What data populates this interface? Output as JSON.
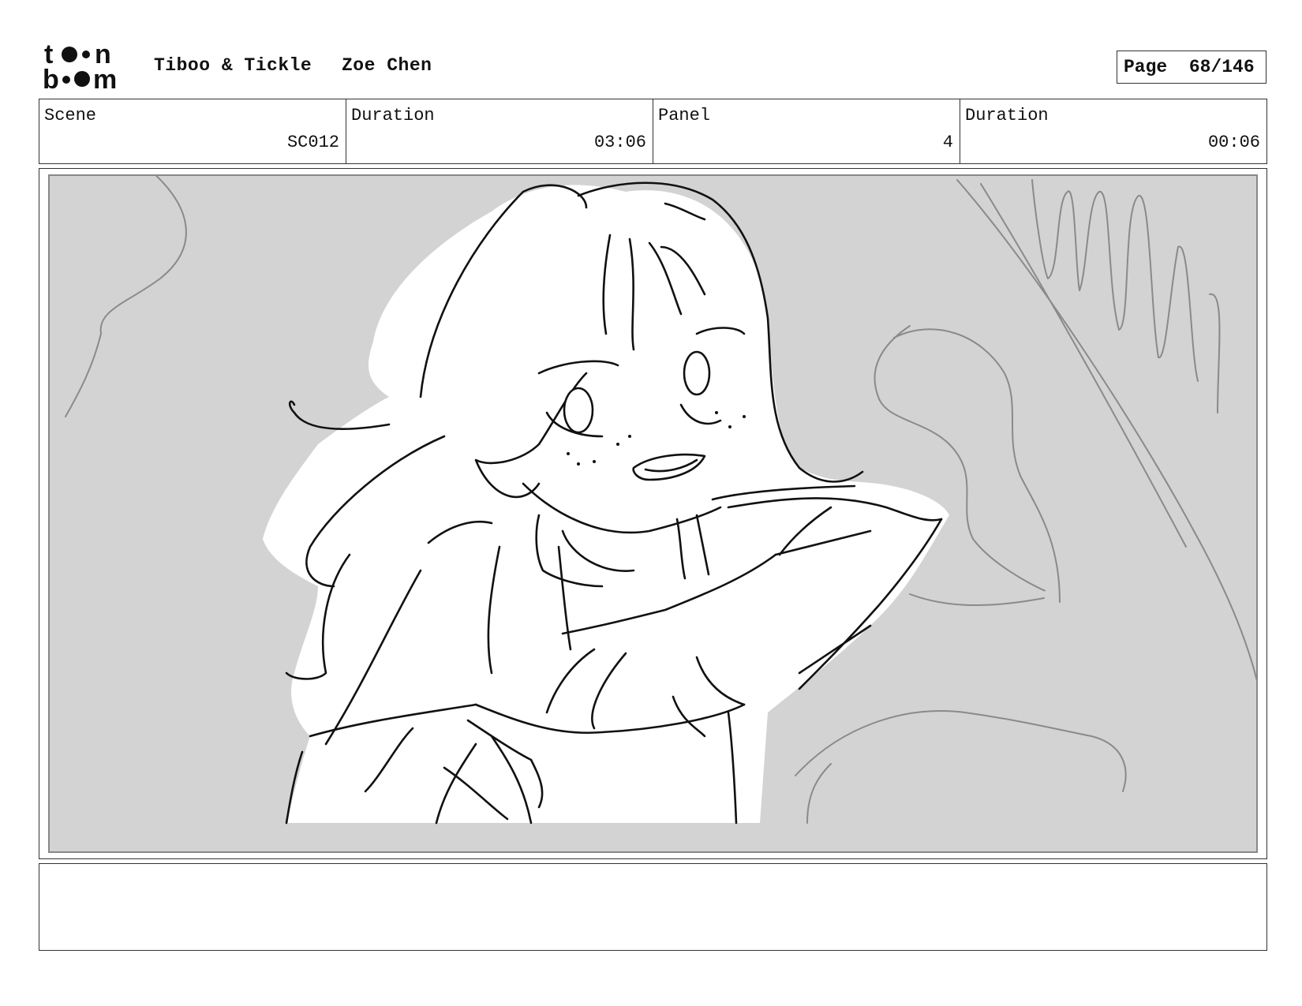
{
  "header": {
    "project_title": "Tiboo & Tickle",
    "artist": "Zoe Chen",
    "page_label": "Page",
    "page_number": "68/146"
  },
  "logo": {
    "brand_text_top": "toon",
    "brand_text_bottom": "boom"
  },
  "info": {
    "scene_label": "Scene",
    "scene_value": "SC012",
    "scene_duration_label": "Duration",
    "scene_duration_value": "03:06",
    "panel_label": "Panel",
    "panel_value": "4",
    "panel_duration_label": "Duration",
    "panel_duration_value": "00:06"
  },
  "panel": {
    "background_color": "#d3d3d3",
    "figure_fill": "#ffffff",
    "line_color": "#111111",
    "sketch_color": "#888888"
  },
  "notes": {
    "text": ""
  }
}
